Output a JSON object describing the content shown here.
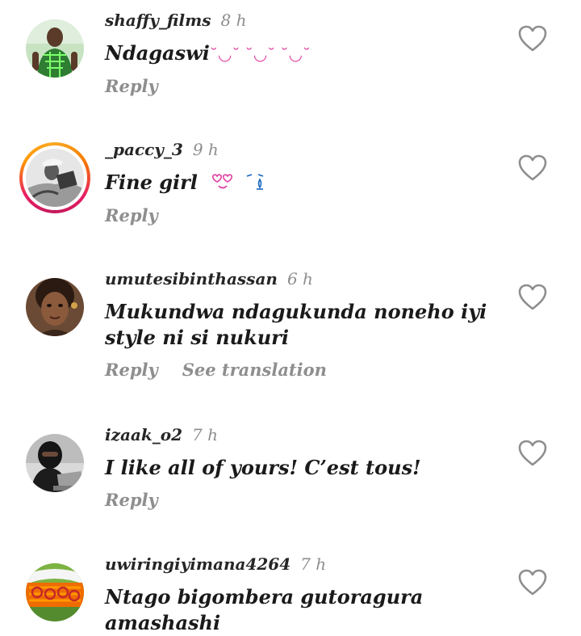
{
  "comments": [
    {
      "username": "shaffy_films",
      "time": "8 h",
      "text": "Ndagaswi",
      "emoji": "˘◡˘ ˘◡˘ ˘◡˘",
      "reply_label": "Reply",
      "avatar_icon": "profile-photo-man-green-shirt"
    },
    {
      "username": "_paccy_3",
      "time": "9 h",
      "text": "Fine girl",
      "emoji": "♡",
      "emoji2": "ˉ̧̦̰̃",
      "reply_label": "Reply",
      "avatar_icon": "profile-photo-story-ring"
    },
    {
      "username": "umutesibinthassan",
      "time": "6 h",
      "text": "Mukundwa ndagukunda noneho iyi style ni si nukuri",
      "reply_label": "Reply",
      "translation_label": "See translation",
      "avatar_icon": "profile-photo-woman-3d"
    },
    {
      "username": "izaak_o2",
      "time": "7 h",
      "text": "I like all of yours! C’est tous!",
      "reply_label": "Reply",
      "avatar_icon": "profile-photo-hooded-laptop"
    },
    {
      "username": "uwiringiyimana4264",
      "time": "7 h",
      "text": "Ntago bigombera gutoragura amashashi",
      "avatar_icon": "profile-photo-salad"
    }
  ],
  "like_icon": "heart-outline-icon",
  "colors": {
    "text": "#1a1a1a",
    "muted": "#8e8e8e",
    "heart": "#8e8e8e",
    "story_ring": "#e91e63"
  }
}
